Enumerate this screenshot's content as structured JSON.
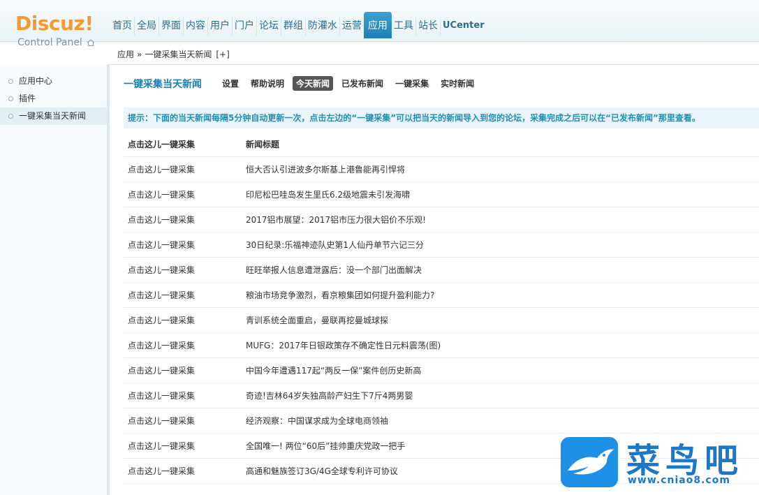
{
  "logo": {
    "brand": "Discuz!",
    "subtitle": "Control Panel"
  },
  "nav": {
    "items": [
      "首页",
      "全局",
      "界面",
      "内容",
      "用户",
      "门户",
      "论坛",
      "群组",
      "防灌水",
      "运营",
      "应用",
      "工具",
      "站长",
      "UCenter"
    ],
    "active": "应用"
  },
  "breadcrumb": {
    "root": "应用",
    "separator": "»",
    "current": "一键采集当天新闻",
    "add": "[+]"
  },
  "sidebar": {
    "items": [
      "应用中心",
      "插件",
      "一键采集当天新闻"
    ],
    "active_index": 2
  },
  "plugin": {
    "title": "一键采集当天新闻",
    "tabs": [
      "设置",
      "帮助说明",
      "今天新闻",
      "已发布新闻",
      "一键采集",
      "实时新闻"
    ],
    "active_tab": "今天新闻"
  },
  "tip": "提示：下面的当天新闻每隔5分钟自动更新一次，点击左边的“一键采集”可以把当天的新闻导入到您的论坛，采集完成之后可以在“已发布新闻”那里查看。",
  "table": {
    "headers": [
      "点击这儿一键采集",
      "新闻标题"
    ],
    "rows": [
      [
        "点击这儿一键采集",
        "恒大否认引进波多尔斯基上港鲁能再引悍将"
      ],
      [
        "点击这儿一键采集",
        "印尼松巴哇岛发生里氏6.2级地震未引发海啸"
      ],
      [
        "点击这儿一键采集",
        "2017铝市展望：2017铝市压力很大铝价不乐观!"
      ],
      [
        "点击这儿一键采集",
        "30日纪录:乐福神迹队史第1人仙丹单节六记三分"
      ],
      [
        "点击这儿一键采集",
        "旺旺举报人信息遭泄露后：没一个部门出面解决"
      ],
      [
        "点击这儿一键采集",
        "粮油市场竞争激烈，看京粮集团如何提升盈利能力?"
      ],
      [
        "点击这儿一键采集",
        "青训系统全面重启，曼联再挖曼城球探"
      ],
      [
        "点击这儿一键采集",
        "MUFG：2017年日银政策存不确定性日元料震荡(图)"
      ],
      [
        "点击这儿一键采集",
        "中国今年遭遇117起“两反一保”案件创历史新高"
      ],
      [
        "点击这儿一键采集",
        "奇迹!吉林64岁失独高龄产妇生下7斤4两男婴"
      ],
      [
        "点击这儿一键采集",
        "经济观察：中国谋求成为全球电商领袖"
      ],
      [
        "点击这儿一键采集",
        "全国唯一! 两位“60后”挂帅重庆党政一把手"
      ],
      [
        "点击这儿一键采集",
        "高通和魅族签订3G/4G全球专利许可协议"
      ]
    ]
  },
  "watermark": {
    "text": "菜鸟吧",
    "url": "www.cniao8.com"
  }
}
